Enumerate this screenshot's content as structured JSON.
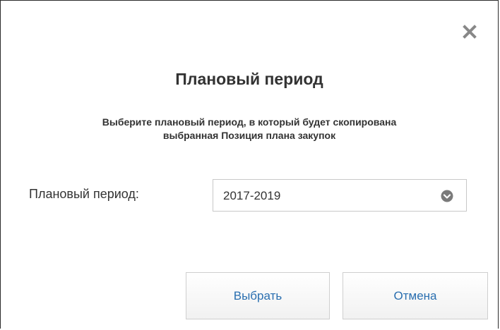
{
  "dialog": {
    "title": "Плановый период",
    "subtitle_line1": "Выберите плановый период, в который будет скопирована",
    "subtitle_line2": "выбранная Позиция плана закупок",
    "close_icon": "close-icon",
    "field": {
      "label": "Плановый период:",
      "selected_value": "2017-2019",
      "chevron_icon": "chevron-down-circle-icon"
    },
    "buttons": {
      "select_label": "Выбрать",
      "cancel_label": "Отмена"
    },
    "colors": {
      "link_blue": "#2a6fb0",
      "text": "#333333",
      "icon_gray": "#888888"
    }
  }
}
